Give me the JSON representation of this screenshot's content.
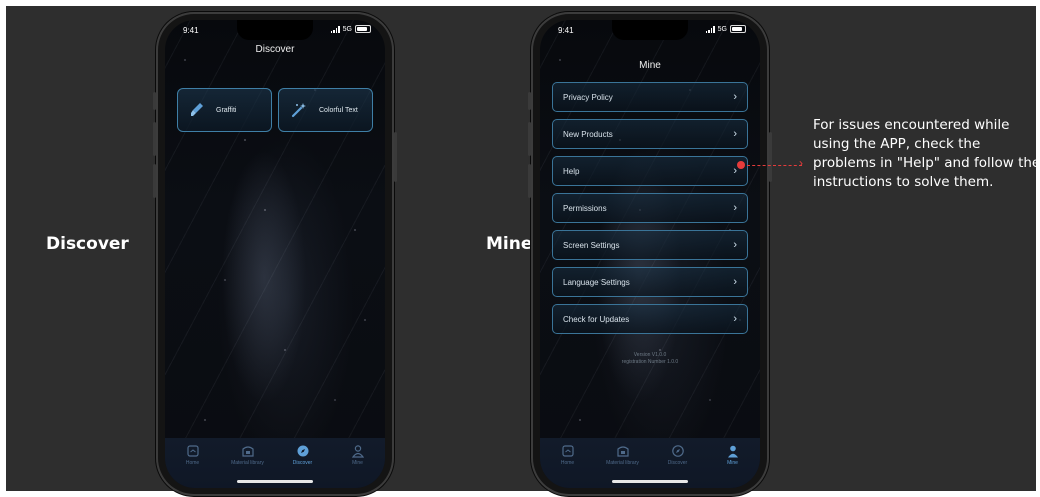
{
  "labels": {
    "discover": "Discover",
    "mine": "Mine"
  },
  "status": {
    "time": "9:41",
    "network": "5G"
  },
  "discover_screen": {
    "title": "Discover",
    "cards": [
      {
        "label": "Graffiti",
        "icon": "paintbrush-icon"
      },
      {
        "label": "Colorful Text",
        "icon": "magic-wand-icon"
      }
    ]
  },
  "mine_screen": {
    "title": "Mine",
    "menu": [
      {
        "label": "Privacy Policy"
      },
      {
        "label": "New Products"
      },
      {
        "label": "Help"
      },
      {
        "label": "Permissions"
      },
      {
        "label": "Screen Settings"
      },
      {
        "label": "Language Settings"
      },
      {
        "label": "Check for Updates"
      }
    ],
    "chevron": "›",
    "version_line1": "Version V1.0.0",
    "version_line2": "registration Number 1.0.0"
  },
  "tabs": [
    {
      "label": "Home",
      "icon": "home-icon"
    },
    {
      "label": "Material library",
      "icon": "library-icon"
    },
    {
      "label": "Discover",
      "icon": "compass-icon"
    },
    {
      "label": "Mine",
      "icon": "person-icon"
    }
  ],
  "callout": {
    "text": "For issues encountered while using the APP, check the problems in \"Help\" and follow the instructions to solve them."
  },
  "colors": {
    "accent": "#3a7498",
    "tab_active": "#5fa0d8",
    "tab_inactive": "#4f6a8a",
    "callout_marker": "#e53b3b",
    "background": "#2e2e2e"
  }
}
